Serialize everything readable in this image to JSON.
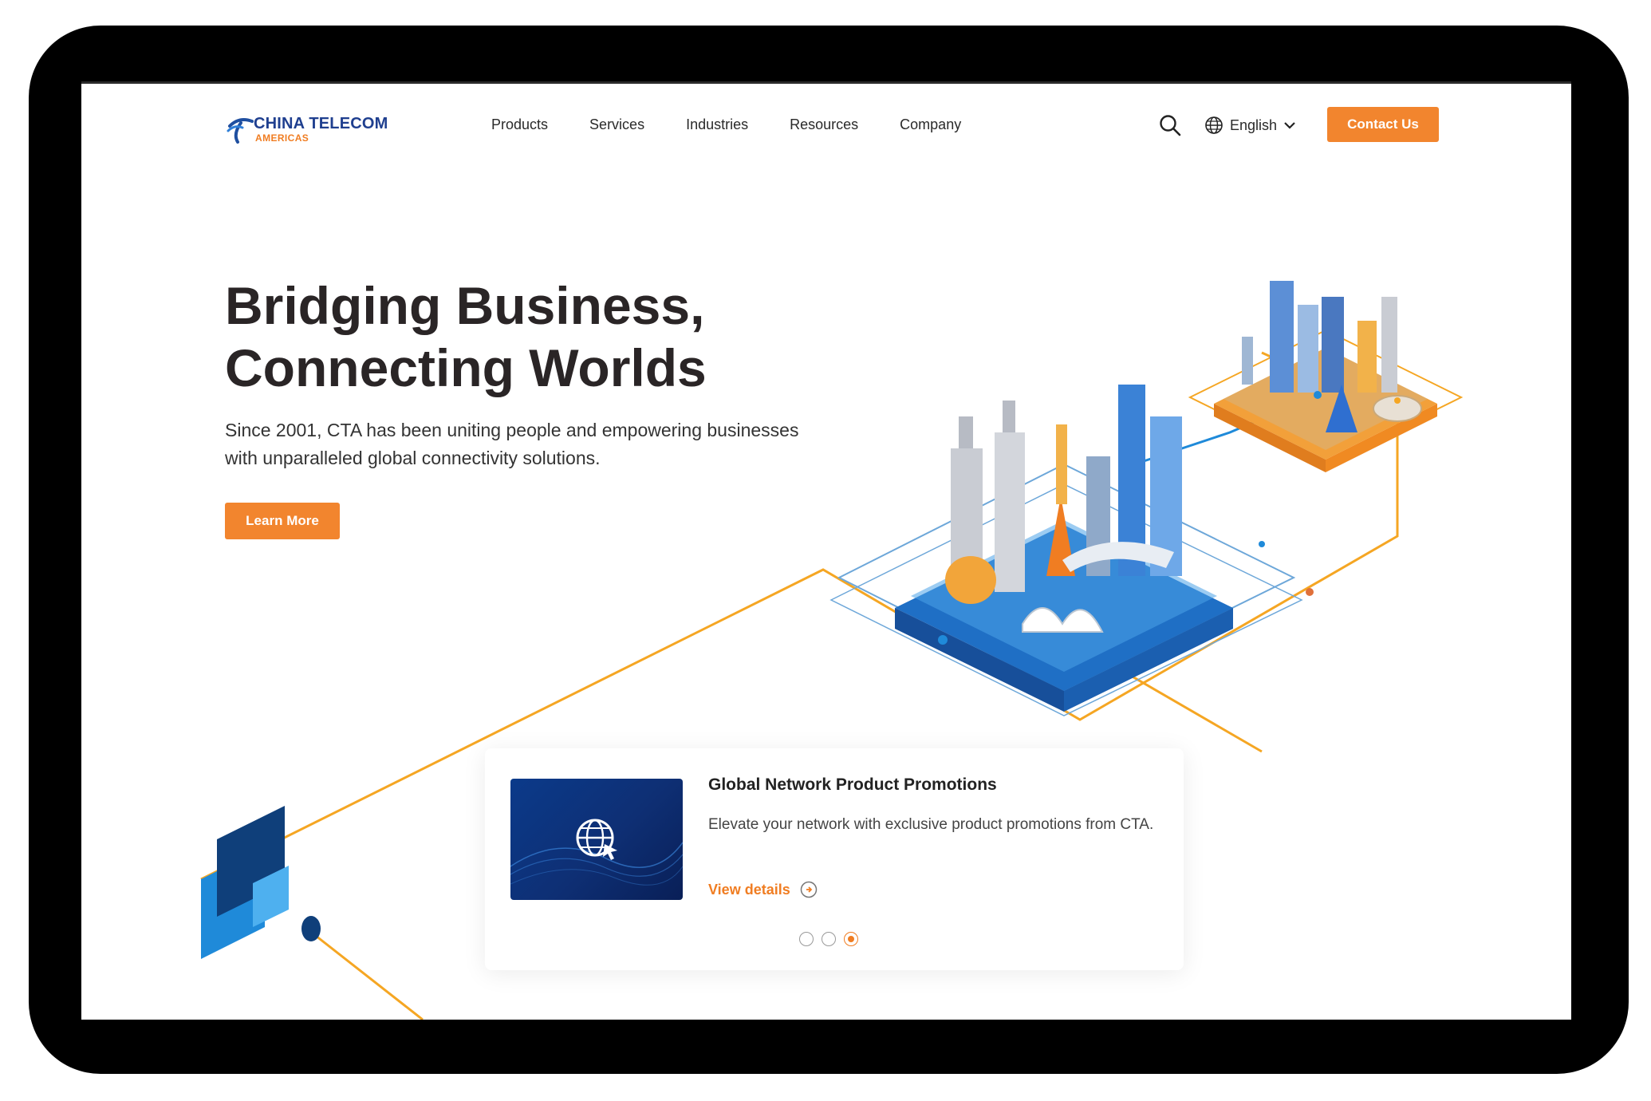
{
  "brand": {
    "name": "CHINA TELECOM",
    "sub": "AMERICAS",
    "accent": "#f2852e",
    "primary": "#1f3f8f"
  },
  "nav": {
    "items": [
      {
        "label": "Products"
      },
      {
        "label": "Services"
      },
      {
        "label": "Industries"
      },
      {
        "label": "Resources"
      },
      {
        "label": "Company"
      }
    ]
  },
  "header": {
    "language": "English",
    "contact_label": "Contact Us",
    "icons": [
      "search-icon",
      "globe-icon",
      "chevron-down-icon"
    ]
  },
  "hero": {
    "title_line1": "Bridging Business,",
    "title_line2": "Connecting Worlds",
    "description": "Since 2001, CTA has been uniting people and empowering businesses with unparalleled global connectivity solutions.",
    "cta_label": "Learn More"
  },
  "promo": {
    "title": "Global Network Product Promotions",
    "description": "Elevate your network with exclusive product promotions from CTA.",
    "link_label": "View details",
    "slides": 3,
    "active_slide": 3
  }
}
